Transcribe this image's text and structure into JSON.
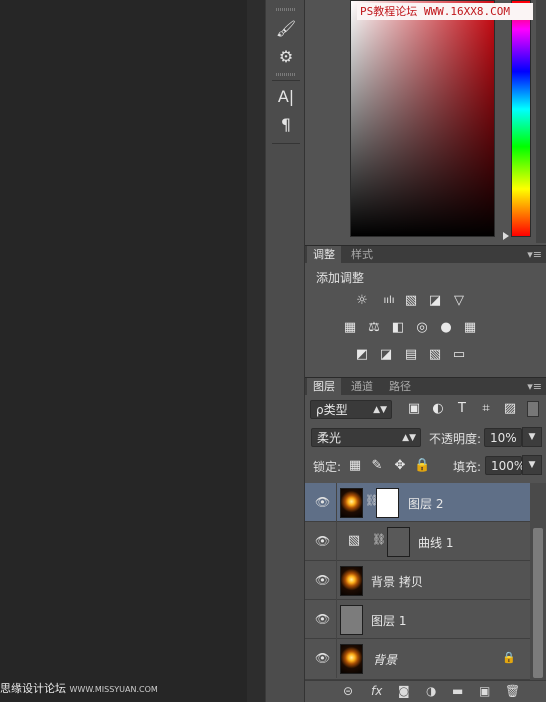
{
  "watermark_top": "PS教程论坛 WWW.16XX8.COM",
  "watermark_bottom": {
    "cn": "思缘设计论坛",
    "url": "WWW.MISSYUAN.COM"
  },
  "tool_strip": {
    "icons": [
      "brushes-icon",
      "brush-settings-icon",
      "character-icon",
      "paragraph-icon"
    ],
    "glyphs": [
      "🖌",
      "⚙",
      "A|",
      "¶"
    ]
  },
  "color_panel": {
    "base_hue": "#d10b14"
  },
  "adjustments": {
    "tabs": [
      "调整",
      "样式"
    ],
    "title": "添加调整",
    "icons_row1": [
      "☼",
      "ıılı",
      "▧",
      "◪",
      "▽"
    ],
    "icons_row2": [
      "▦",
      "⚖",
      "◧",
      "◎",
      "●",
      "▦"
    ],
    "icons_row3": [
      "◩",
      "◪",
      "▤",
      "▧",
      "▭"
    ]
  },
  "layers": {
    "tabs": [
      "图层",
      "通道",
      "路径"
    ],
    "filter_label": "ρ类型",
    "blend_mode": "柔光",
    "opacity_label": "不透明度:",
    "opacity_value": "10%",
    "lock_label": "锁定:",
    "fill_label": "填充:",
    "fill_value": "100%",
    "items": [
      {
        "name": "图层 2",
        "selected": true
      },
      {
        "name": "曲线 1",
        "selected": false
      },
      {
        "name": "背景 拷贝",
        "selected": false
      },
      {
        "name": "图层 1",
        "selected": false
      },
      {
        "name": "背景",
        "selected": false,
        "locked": true
      }
    ],
    "footer_icons": [
      "link-icon",
      "fx-icon",
      "mask-icon",
      "adjustment-icon",
      "group-icon",
      "new-layer-icon",
      "trash-icon"
    ],
    "footer_glyphs": [
      "⊝",
      "fx",
      "◙",
      "◑",
      "▬",
      "▣",
      "🗑"
    ]
  }
}
